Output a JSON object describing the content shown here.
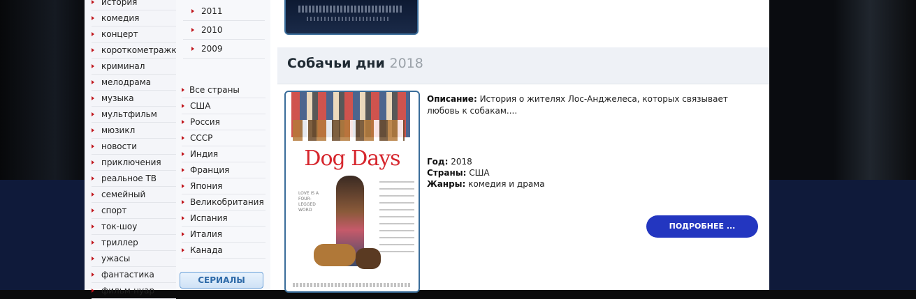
{
  "sidebar": {
    "genres": [
      "история",
      "комедия",
      "концерт",
      "короткометражка",
      "криминал",
      "мелодрама",
      "музыка",
      "мультфильм",
      "мюзикл",
      "новости",
      "приключения",
      "реальное ТВ",
      "семейный",
      "спорт",
      "ток-шоу",
      "триллер",
      "ужасы",
      "фантастика",
      "фильм-нуар"
    ]
  },
  "years": [
    "2011",
    "2010",
    "2009"
  ],
  "countries": [
    "Все страны",
    "США",
    "Россия",
    "СССР",
    "Индия",
    "Франция",
    "Япония",
    "Великобритания",
    "Испания",
    "Италия",
    "Канада"
  ],
  "serials_label": "СЕРИАЛЫ",
  "movie": {
    "title": "Собачьи дни",
    "year": "2018",
    "poster_logo": "Dog Days",
    "poster_tagline": "LOVE IS A FOUR-LEGGED WORD",
    "desc_label": "Описание:",
    "description": "История о жителях Лос-Анджелеса, которых связывает любовь к собакам....",
    "year_label": "Год:",
    "year_value": "2018",
    "countries_label": "Страны:",
    "countries_value": "США",
    "genres_label": "Жанры:",
    "genres_value": "комедия и драма",
    "more_label": "ПОДРОБНЕЕ ..."
  },
  "colors": {
    "accent": "#2336c0",
    "arrow": "#c0151b",
    "page_bg_bottom": "#0f1a3a"
  }
}
